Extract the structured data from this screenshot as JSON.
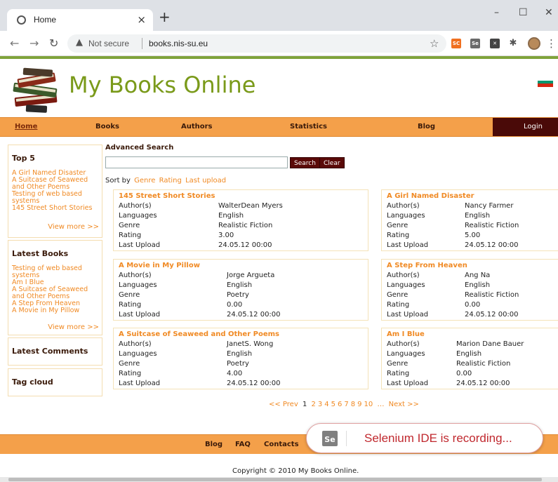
{
  "browser": {
    "tab_title": "Home",
    "tab_close": "×",
    "new_tab": "+",
    "not_secure": "Not secure",
    "url": "books.nis-su.eu",
    "window_controls": [
      "–",
      "☐",
      "✕"
    ],
    "ext_sc": "SC",
    "ext_se": "Se"
  },
  "site": {
    "brand": "My Books Online",
    "menu": {
      "home": "Home",
      "books": "Books",
      "authors": "Authors",
      "statistics": "Statistics",
      "blog": "Blog",
      "login": "Login"
    },
    "top5": {
      "title": "Top 5",
      "items": [
        "A Girl Named Disaster",
        "A Suitcase of Seaweed and Other Poems",
        "Testing of web based systems",
        "145 Street Short Stories"
      ],
      "more": "View more >>"
    },
    "latest_books": {
      "title": "Latest Books",
      "items": [
        "Testing of web based systems",
        "Am I Blue",
        "A Suitcase of Seaweed and Other Poems",
        "A Step From Heaven",
        "A Movie in My Pillow"
      ],
      "more": "View more >>"
    },
    "latest_comments": {
      "title": "Latest Comments"
    },
    "tag_cloud": {
      "title": "Tag cloud"
    },
    "search": {
      "title": "Advanced Search",
      "value": "",
      "search_button": "Search",
      "clear_button": "Clear"
    },
    "sort": {
      "label": "Sort by",
      "options": [
        "Genre",
        "Rating",
        "Last upload"
      ]
    },
    "field_labels": {
      "authors": "Author(s)",
      "languages": "Languages",
      "genre": "Genre",
      "rating": "Rating",
      "last_upload": "Last Upload"
    },
    "books": [
      {
        "title": "145 Street Short Stories",
        "author": "WalterDean Myers",
        "language": "English",
        "genre": "Realistic Fiction",
        "rating": "3.00",
        "upload": "24.05.12 00:00"
      },
      {
        "title": "A Girl Named Disaster",
        "author": "Nancy Farmer",
        "language": "English",
        "genre": "Realistic Fiction",
        "rating": "5.00",
        "upload": "24.05.12 00:00"
      },
      {
        "title": "A Movie in My Pillow",
        "author": "Jorge Argueta",
        "language": "English",
        "genre": "Poetry",
        "rating": "0.00",
        "upload": "24.05.12 00:00"
      },
      {
        "title": "A Step From Heaven",
        "author": "Ang Na",
        "language": "English",
        "genre": "Realistic Fiction",
        "rating": "0.00",
        "upload": "24.05.12 00:00"
      },
      {
        "title": "A Suitcase of Seaweed and Other Poems",
        "author": "JanetS. Wong",
        "language": "English",
        "genre": "Poetry",
        "rating": "4.00",
        "upload": "24.05.12 00:00"
      },
      {
        "title": "Am I Blue",
        "author": "Marion Dane Bauer",
        "language": "English",
        "genre": "Realistic Fiction",
        "rating": "0.00",
        "upload": "24.05.12 00:00"
      }
    ],
    "pager": {
      "prev": "<< Prev",
      "current": "1",
      "pages": [
        "2",
        "3",
        "4",
        "5",
        "6",
        "7",
        "8",
        "9",
        "10"
      ],
      "ellipsis": "…",
      "next": "Next >>"
    },
    "footer": {
      "blog": "Blog",
      "faq": "FAQ",
      "contacts": "Contacts",
      "copyright": "Copyright © 2010 My Books Online."
    }
  },
  "selenium_banner": {
    "icon": "Se",
    "message": "Selenium IDE is recording..."
  },
  "colors": {
    "accent_orange": "#f4a04a",
    "link_orange": "#f08a24",
    "brand_green": "#7a9a1a",
    "dark_maroon": "#4a0a08",
    "selenium_red": "#c0282e"
  }
}
